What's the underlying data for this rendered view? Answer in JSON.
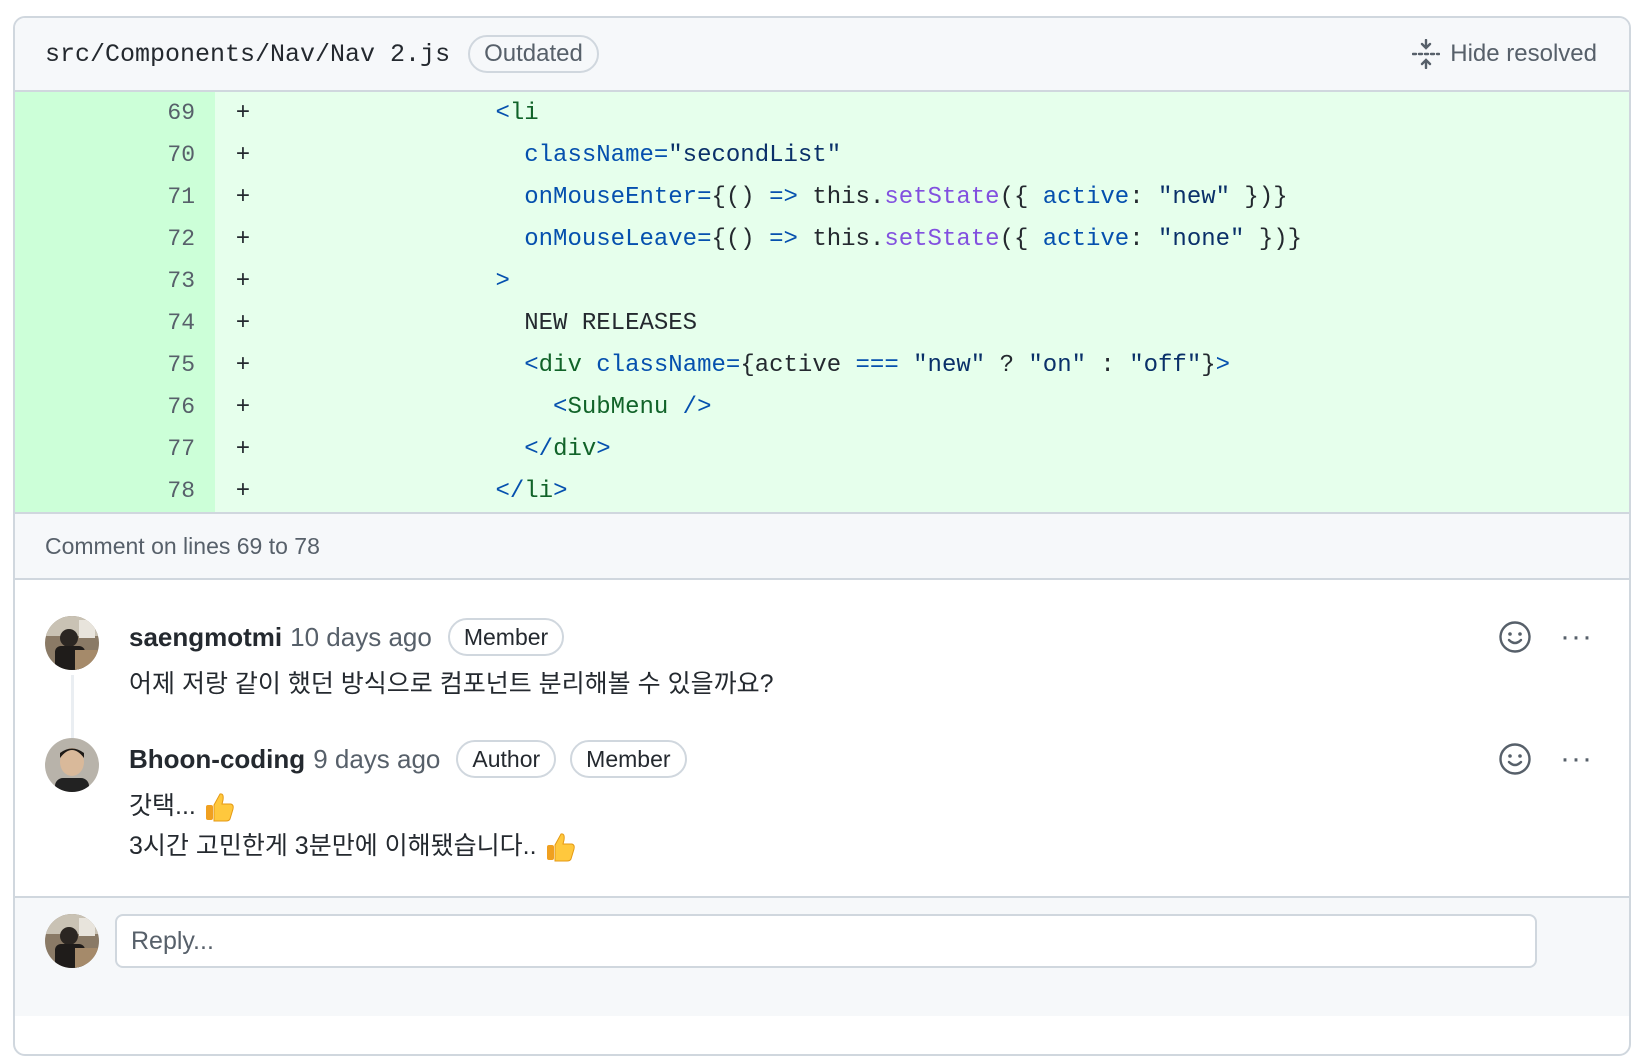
{
  "header": {
    "file_path": "src/Components/Nav/Nav 2.js",
    "outdated_label": "Outdated",
    "hide_resolved_label": "Hide resolved"
  },
  "diff": {
    "marker": "+",
    "lines": [
      {
        "num": "69"
      },
      {
        "num": "70"
      },
      {
        "num": "71"
      },
      {
        "num": "72"
      },
      {
        "num": "73"
      },
      {
        "num": "74"
      },
      {
        "num": "75"
      },
      {
        "num": "76"
      },
      {
        "num": "77"
      },
      {
        "num": "78"
      }
    ],
    "code": {
      "l69": {
        "open": "<",
        "tag": "li"
      },
      "l70": {
        "attr": "className=",
        "str": "\"secondList\""
      },
      "l71": {
        "attr": "onMouseEnter=",
        "p1": "{()",
        "arrow": " =>",
        "p2": " this.",
        "fn": "setState",
        "p3": "({ ",
        "key": "active",
        "p4": ": ",
        "str": "\"new\"",
        "p5": " })}"
      },
      "l72": {
        "attr": "onMouseLeave=",
        "p1": "{()",
        "arrow": " =>",
        "p2": " this.",
        "fn": "setState",
        "p3": "({ ",
        "key": "active",
        "p4": ": ",
        "str": "\"none\"",
        "p5": " })}"
      },
      "l73": {
        "close": ">"
      },
      "l74": {
        "text": "NEW RELEASES"
      },
      "l75": {
        "open": "<",
        "tag": "div",
        "attr": " className=",
        "p1": "{active ",
        "op": "===",
        "s1": " \"new\"",
        "p2": " ? ",
        "s2": "\"on\"",
        "p3": " : ",
        "s3": "\"off\"",
        "p4": "}",
        "close": ">"
      },
      "l76": {
        "open": "<",
        "tag": "SubMenu",
        "close": " />"
      },
      "l77": {
        "open": "</",
        "tag": "div",
        "close": ">"
      },
      "l78": {
        "open": "</",
        "tag": "li",
        "close": ">"
      }
    }
  },
  "comment_on": "Comment on lines 69 to 78",
  "comments": [
    {
      "author": "saengmotmi",
      "time": "10 days ago",
      "badges": [
        "Member"
      ],
      "text": "어제 저랑 같이 했던 방식으로 컴포넌트 분리해볼 수 있을까요?"
    },
    {
      "author": "Bhoon-coding",
      "time": "9 days ago",
      "badges": [
        "Author",
        "Member"
      ],
      "text_line1": "갓택...",
      "text_line2": "3시간 고민한게 3분만에 이해됐습니다.."
    }
  ],
  "more_label": "···",
  "reply": {
    "placeholder": "Reply..."
  }
}
